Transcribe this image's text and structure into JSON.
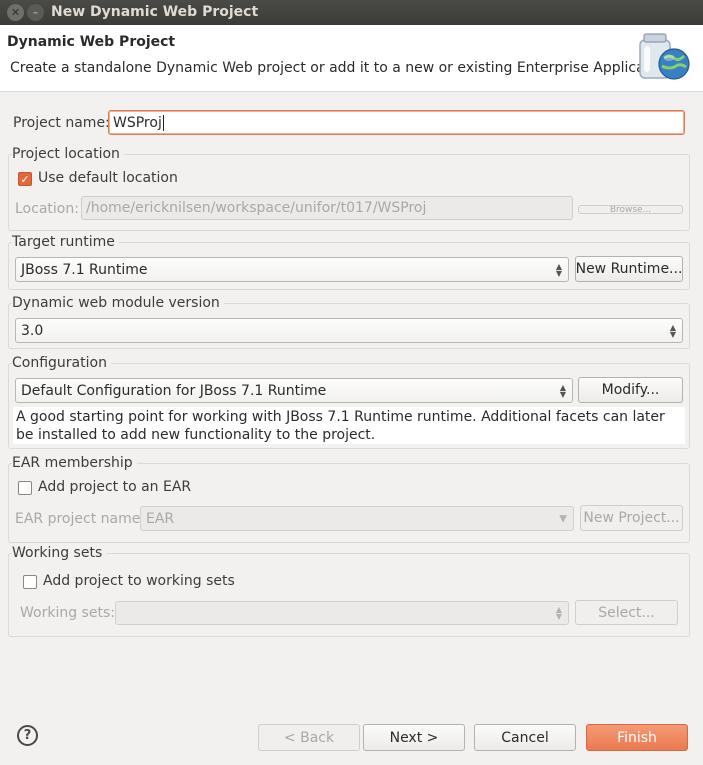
{
  "window": {
    "title": "New Dynamic Web Project"
  },
  "banner": {
    "title": "Dynamic Web Project",
    "description": "Create a standalone Dynamic Web project or add it to a new or existing Enterprise Application.",
    "icon": "web-project-jar-globe-icon"
  },
  "project_name": {
    "label": "Project name:",
    "value": "WSProj"
  },
  "project_location": {
    "title": "Project location",
    "use_default_label": "Use default location",
    "use_default_checked": true,
    "location_label": "Location:",
    "location_value": "/home/ericknilsen/workspace/unifor/t017/WSProj",
    "browse_label": "Browse..."
  },
  "target_runtime": {
    "title": "Target runtime",
    "selected": "JBoss 7.1 Runtime",
    "new_runtime_label": "New Runtime..."
  },
  "module_version": {
    "title": "Dynamic web module version",
    "selected": "3.0"
  },
  "configuration": {
    "title": "Configuration",
    "selected": "Default Configuration for JBoss 7.1 Runtime",
    "modify_label": "Modify...",
    "description": "A good starting point for working with JBoss 7.1 Runtime runtime. Additional facets can later be installed to add new functionality to the project."
  },
  "ear": {
    "title": "EAR membership",
    "add_label": "Add project to an EAR",
    "add_checked": false,
    "project_name_label": "EAR project name:",
    "project_name_value": "EAR",
    "new_project_label": "New Project..."
  },
  "working_sets": {
    "title": "Working sets",
    "add_label": "Add project to working sets",
    "add_checked": false,
    "sets_label": "Working sets:",
    "sets_value": "",
    "select_label": "Select..."
  },
  "footer": {
    "help_icon": "help-icon",
    "back_label": "< Back",
    "next_label": "Next >",
    "cancel_label": "Cancel",
    "finish_label": "Finish"
  },
  "colors": {
    "accent": "#e5683a",
    "finish_button": "#ef8a63",
    "titlebar": "#3f3f3b"
  }
}
